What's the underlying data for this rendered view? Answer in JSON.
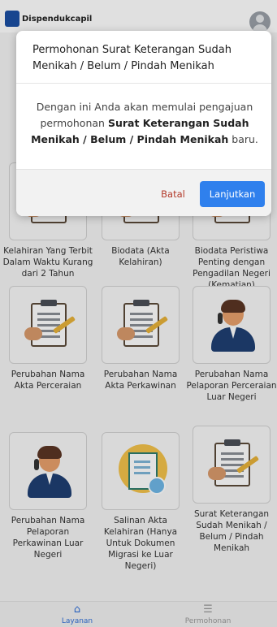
{
  "header": {
    "brand": "Dispendukcapil"
  },
  "services": [
    {
      "label": "Kelahiran Yang Terbit Dalam Waktu Kurang dari 2 Tahun",
      "icon": "clipboard-icon"
    },
    {
      "label": "Biodata (Akta Kelahiran)",
      "icon": "clipboard-icon"
    },
    {
      "label": "Biodata Peristiwa Penting dengan Pengadilan Negeri (Kematian)",
      "icon": "clipboard-icon"
    },
    {
      "label": "Perubahan Nama Akta Perceraian",
      "icon": "clipboard-icon"
    },
    {
      "label": "Perubahan Nama Akta Perkawinan",
      "icon": "clipboard-icon"
    },
    {
      "label": "Perubahan Nama Pelaporan Perceraian Luar Negeri",
      "icon": "call-agent-icon"
    },
    {
      "label": "Perubahan Nama Pelaporan Perkawinan Luar Negeri",
      "icon": "call-agent-icon"
    },
    {
      "label": "Salinan Akta Kelahiran (Hanya Untuk Dokumen Migrasi ke Luar Negeri)",
      "icon": "document-icon"
    },
    {
      "label": "Surat Keterangan Sudah Menikah / Belum / Pindah Menikah",
      "icon": "clipboard-icon"
    }
  ],
  "modal": {
    "title": "Permohonan Surat Keterangan Sudah Menikah / Belum / Pindah Menikah",
    "body_prefix": "Dengan ini Anda akan memulai pengajuan permohonan",
    "body_bold": "Surat Keterangan Sudah Menikah / Belum / Pindah Menikah",
    "body_suffix": "baru.",
    "cancel_label": "Batal",
    "confirm_label": "Lanjutkan"
  },
  "nav": {
    "items": [
      {
        "label": "Layanan",
        "icon": "home-icon",
        "active": true
      },
      {
        "label": "Permohonan",
        "icon": "list-icon",
        "active": false
      }
    ]
  },
  "colors": {
    "primary": "#2f80ed",
    "cancel": "#b33a2a",
    "nav_active": "#2f6fd8",
    "nav_inactive": "#999999"
  }
}
